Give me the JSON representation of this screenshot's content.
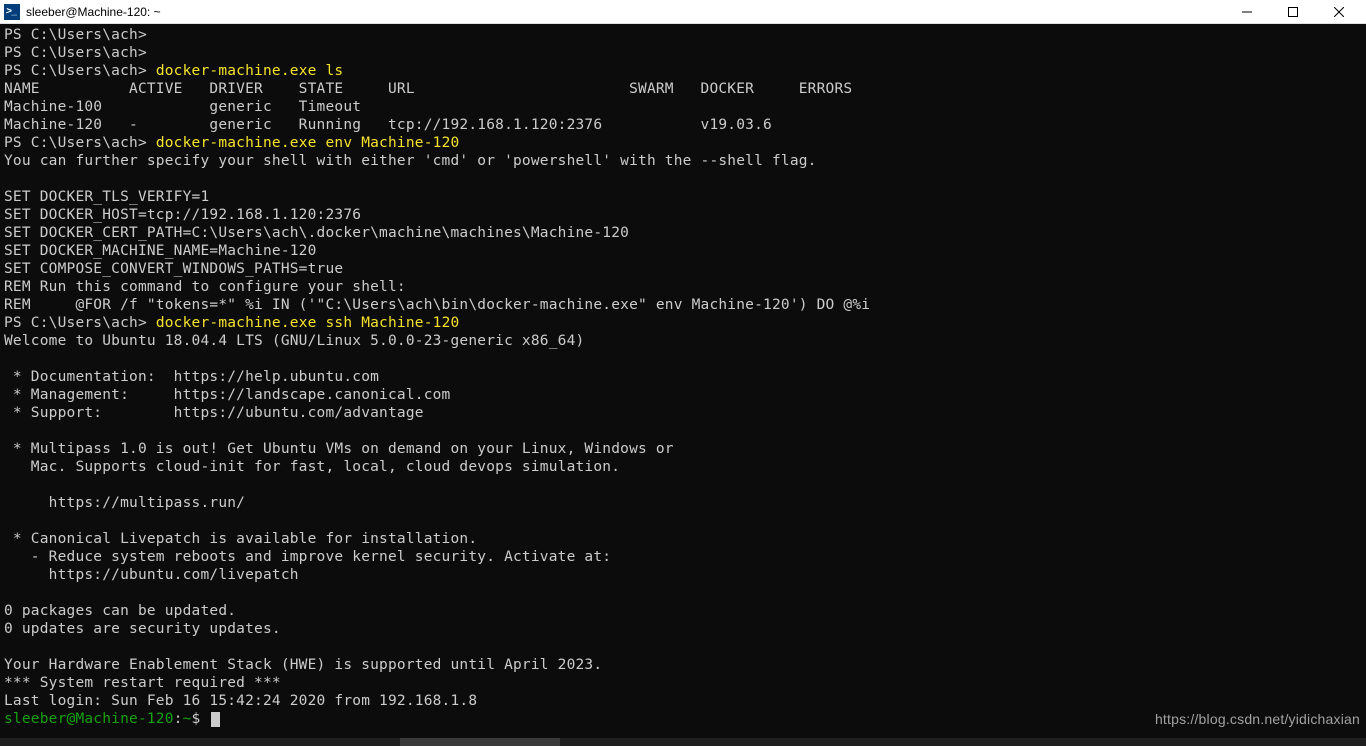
{
  "window": {
    "title": "sleeber@Machine-120: ~"
  },
  "ps_prompt": "PS C:\\Users\\ach> ",
  "cmds": {
    "ls": "docker-machine.exe ls",
    "env": "docker-machine.exe env Machine-120",
    "ssh": "docker-machine.exe ssh Machine-120"
  },
  "ls_header": "NAME          ACTIVE   DRIVER    STATE     URL                        SWARM   DOCKER     ERRORS",
  "ls_rows": [
    "Machine-100            generic   Timeout",
    "Machine-120   -        generic   Running   tcp://192.168.1.120:2376           v19.03.6"
  ],
  "env_out": [
    "You can further specify your shell with either 'cmd' or 'powershell' with the --shell flag.",
    "",
    "SET DOCKER_TLS_VERIFY=1",
    "SET DOCKER_HOST=tcp://192.168.1.120:2376",
    "SET DOCKER_CERT_PATH=C:\\Users\\ach\\.docker\\machine\\machines\\Machine-120",
    "SET DOCKER_MACHINE_NAME=Machine-120",
    "SET COMPOSE_CONVERT_WINDOWS_PATHS=true",
    "REM Run this command to configure your shell:",
    "REM     @FOR /f \"tokens=*\" %i IN ('\"C:\\Users\\ach\\bin\\docker-machine.exe\" env Machine-120') DO @%i"
  ],
  "ssh_out": [
    "Welcome to Ubuntu 18.04.4 LTS (GNU/Linux 5.0.0-23-generic x86_64)",
    "",
    " * Documentation:  https://help.ubuntu.com",
    " * Management:     https://landscape.canonical.com",
    " * Support:        https://ubuntu.com/advantage",
    "",
    " * Multipass 1.0 is out! Get Ubuntu VMs on demand on your Linux, Windows or",
    "   Mac. Supports cloud-init for fast, local, cloud devops simulation.",
    "",
    "     https://multipass.run/",
    "",
    " * Canonical Livepatch is available for installation.",
    "   - Reduce system reboots and improve kernel security. Activate at:",
    "     https://ubuntu.com/livepatch",
    "",
    "0 packages can be updated.",
    "0 updates are security updates.",
    "",
    "Your Hardware Enablement Stack (HWE) is supported until April 2023.",
    "*** System restart required ***",
    "Last login: Sun Feb 16 15:42:24 2020 from 192.168.1.8"
  ],
  "ssh_prompt": {
    "userhost": "sleeber@Machine-120",
    "sep": ":",
    "path": "~",
    "tail": "$"
  },
  "watermark": "https://blog.csdn.net/yidichaxian"
}
